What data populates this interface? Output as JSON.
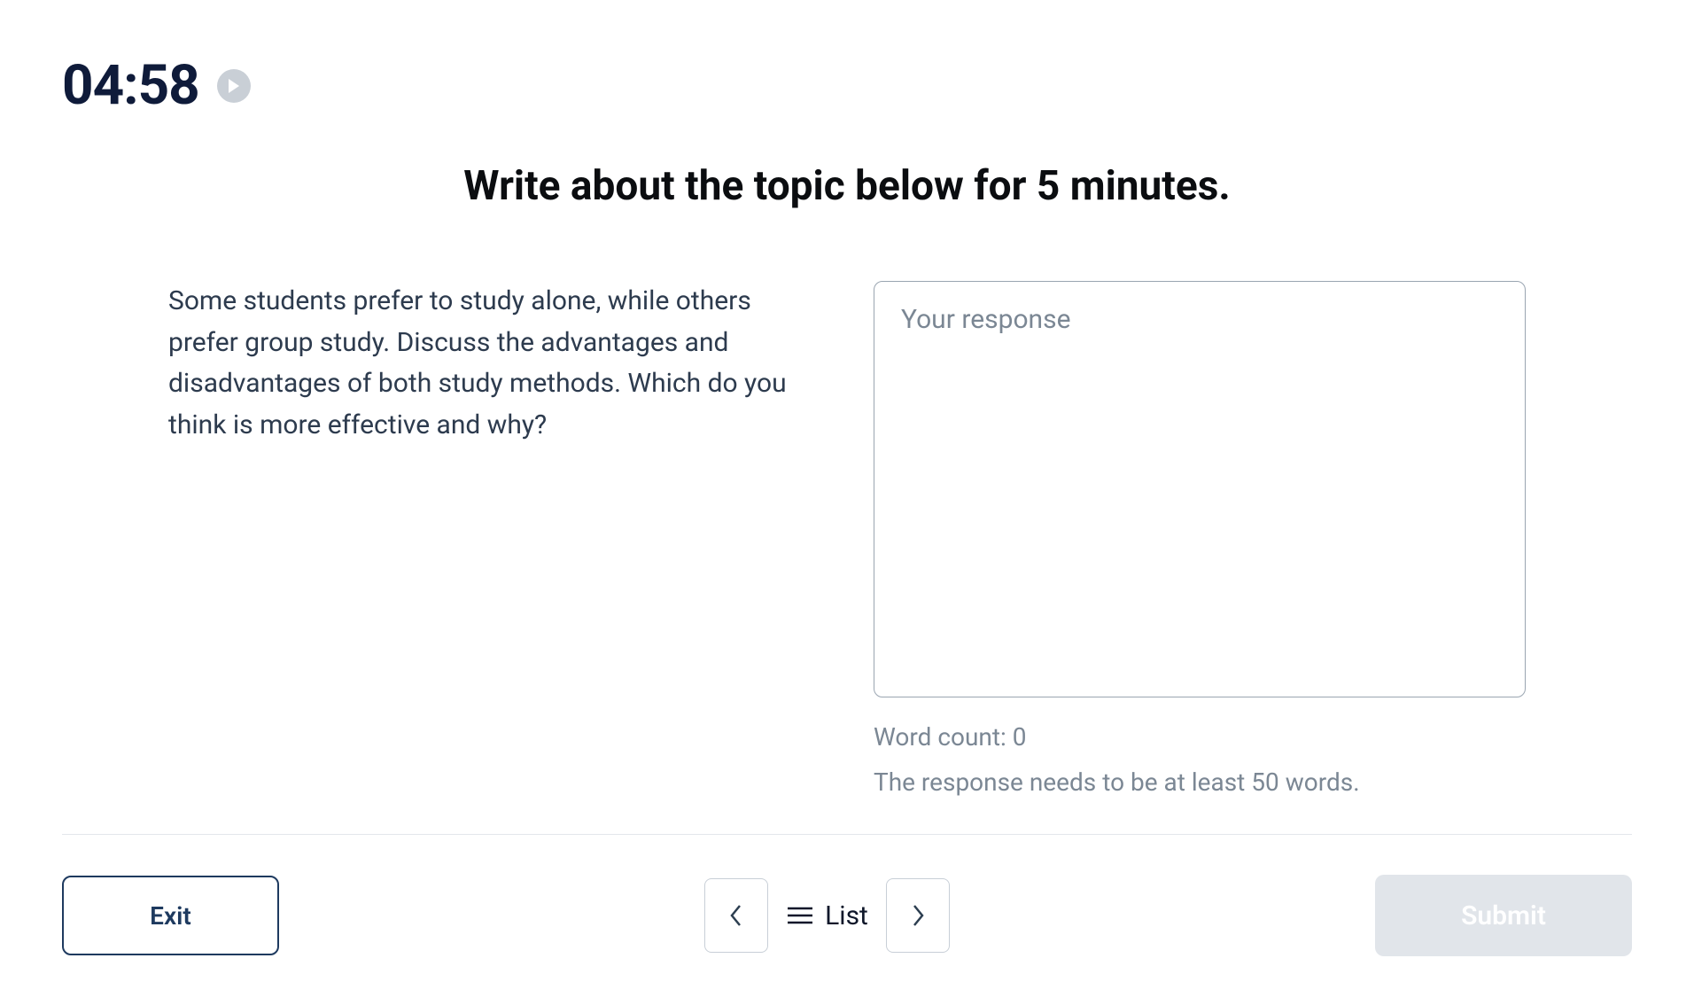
{
  "timer": {
    "value": "04:58"
  },
  "instruction": "Write about the topic below for 5 minutes.",
  "prompt_text": "Some students prefer to study alone, while others prefer group study. Discuss the advantages and disadvantages of both study methods. Which do you think is more effective and why?",
  "response": {
    "placeholder": "Your response",
    "value": ""
  },
  "word_count_label": "Word count: 0",
  "min_words_label": "The response needs to be at least 50 words.",
  "footer": {
    "exit_label": "Exit",
    "list_label": "List",
    "submit_label": "Submit"
  }
}
